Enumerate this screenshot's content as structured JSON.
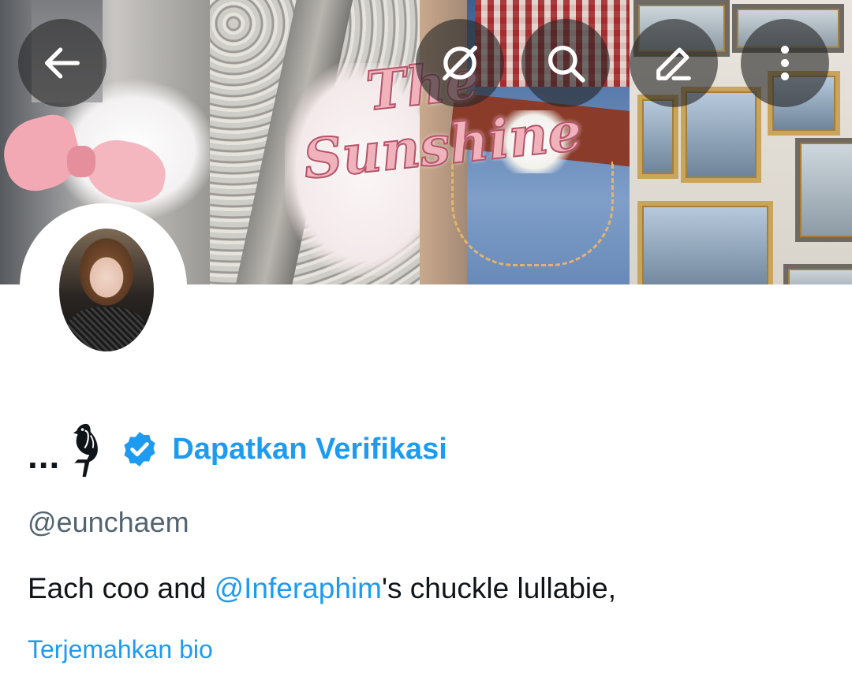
{
  "banner": {
    "title_line1": "The",
    "title_line2": "Sunshine"
  },
  "toolbar": {
    "back_icon": "arrow-left-icon",
    "grok_icon": "grok-icon",
    "search_icon": "search-icon",
    "edit_icon": "pencil-icon",
    "more_icon": "more-vertical-icon"
  },
  "profile": {
    "display_name": "...",
    "name_emoji_icon": "falcon-icon",
    "verified_icon": "verified-badge-icon",
    "verify_link": "Dapatkan Verifikasi",
    "handle": "@eunchaem",
    "bio_prefix": "Each coo and ",
    "bio_mention": "@Inferaphim",
    "bio_suffix": "'s chuckle lullabie,",
    "translate_link": "Terjemahkan bio"
  },
  "colors": {
    "accent": "#1d9bf0",
    "text_primary": "#0f1419",
    "text_secondary": "#536471",
    "button_overlay": "rgba(38,38,38,0.62)"
  }
}
